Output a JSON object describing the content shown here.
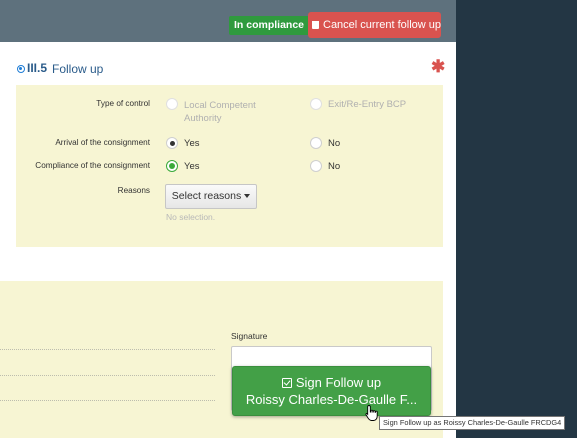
{
  "topbar": {
    "compliance_badge": "In compliance",
    "cancel_button": "Cancel current follow up",
    "colors": {
      "bar": "#5e717d",
      "badge": "#2f9a3e",
      "cancel": "#d9534f",
      "sidebar": "#233644"
    }
  },
  "section": {
    "number": "III.5",
    "title": "Follow up",
    "required_mark": "✱"
  },
  "form": {
    "type_of_control": {
      "label": "Type of control",
      "options": [
        "Local Competent Authority",
        "Exit/Re-Entry BCP"
      ],
      "option1_line1": "Local Competent",
      "option1_line2": "Authority",
      "selected": null
    },
    "arrival": {
      "label": "Arrival of the consignment",
      "yes": "Yes",
      "no": "No",
      "selected": "Yes"
    },
    "compliance": {
      "label": "Compliance of the consignment",
      "yes": "Yes",
      "no": "No",
      "selected": "Yes"
    },
    "reasons": {
      "label": "Reasons",
      "button": "Select reasons",
      "empty_text": "No selection."
    }
  },
  "signature": {
    "label": "Signature",
    "button_line1": "Sign Follow up",
    "button_line2": "Roissy Charles-De-Gaulle F...",
    "tooltip": "Sign Follow up as Roissy Charles-De-Gaulle FRCDG4"
  }
}
